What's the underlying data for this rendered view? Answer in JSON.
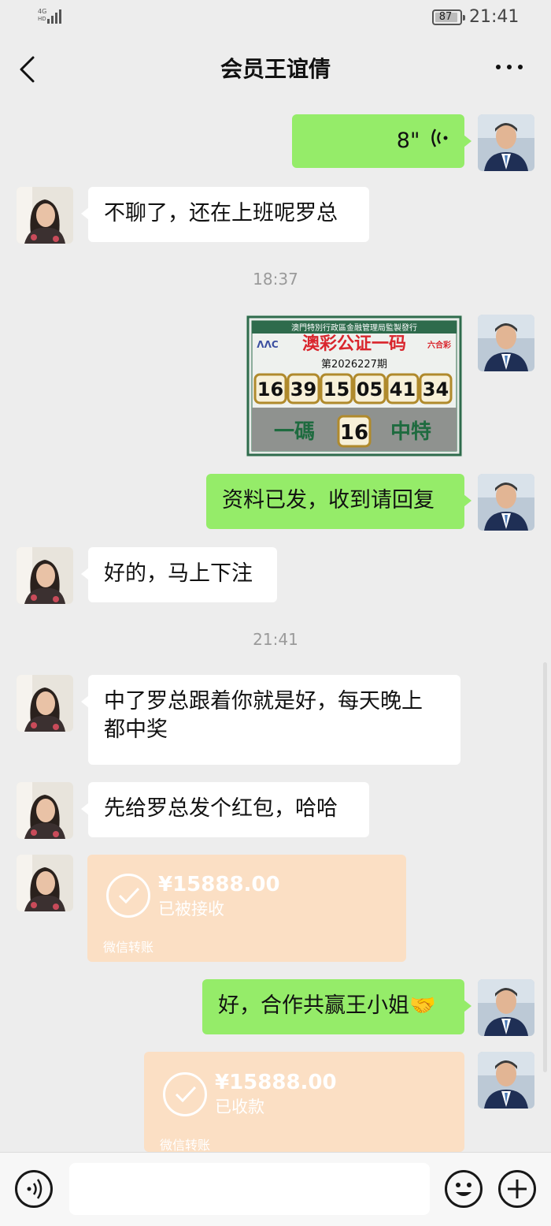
{
  "status_bar": {
    "network": "4G",
    "network_sub": "HD",
    "battery": "87",
    "time": "21:41"
  },
  "header": {
    "title": "会员王谊倩"
  },
  "messages": [
    {
      "side": "right",
      "type": "voice",
      "duration": "8\""
    },
    {
      "side": "left",
      "type": "text",
      "text": "不聊了，还在上班呢罗总"
    },
    {
      "type": "time",
      "text": "18:37"
    },
    {
      "side": "right",
      "type": "image",
      "image": {
        "top_text": "澳門特別行政區金融管理局監製發行",
        "logo_left": "ΛΛC",
        "title": "澳彩公证一码",
        "logo_right": "六合彩",
        "issue": "第2026227期",
        "numbers": [
          "16",
          "39",
          "15",
          "05",
          "41",
          "34"
        ],
        "bottom_left": "一碼",
        "special": "16",
        "bottom_right": "中特"
      }
    },
    {
      "side": "right",
      "type": "text",
      "text": "资料已发，收到请回复"
    },
    {
      "side": "left",
      "type": "text",
      "text": "好的，马上下注"
    },
    {
      "type": "time",
      "text": "21:41"
    },
    {
      "side": "left",
      "type": "text",
      "text_line1": "中了罗总跟着你就是好，每天晚上",
      "text_line2": "都中奖"
    },
    {
      "side": "left",
      "type": "text",
      "text": "先给罗总发个红包，哈哈"
    },
    {
      "side": "left",
      "type": "transfer",
      "amount": "¥15888.00",
      "status": "已被接收",
      "footer": "微信转账"
    },
    {
      "side": "right",
      "type": "text",
      "text": "好，合作共赢王小姐🤝"
    },
    {
      "side": "right",
      "type": "transfer",
      "amount": "¥15888.00",
      "status": "已收款",
      "footer": "微信转账"
    }
  ],
  "icons": {
    "back": "back-icon",
    "more": "more-icon",
    "voice_wave": "voice-wave-icon",
    "voice_input": "voice-input-icon",
    "emoji": "emoji-icon",
    "plus": "plus-icon",
    "check": "check-icon"
  },
  "colors": {
    "background": "#ededed",
    "self_bubble": "#95ec69",
    "other_bubble": "#ffffff",
    "transfer_card": "#fbdfc4"
  }
}
